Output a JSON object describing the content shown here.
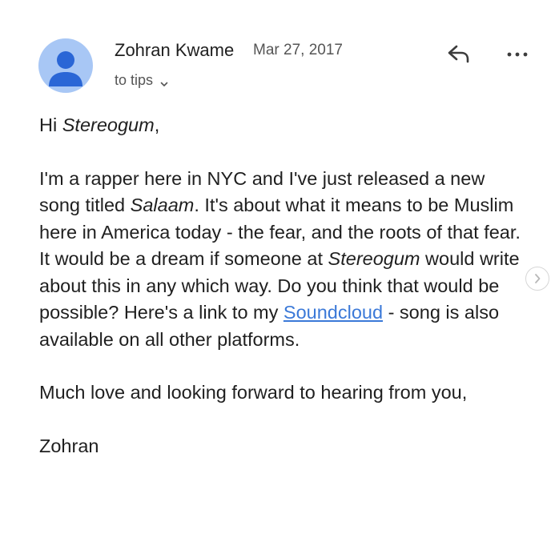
{
  "sender": {
    "name": "Zohran Kwame",
    "date": "Mar 27, 2017",
    "avatar_color": "#a8c7f5",
    "avatar_icon": "person-icon"
  },
  "recipient": {
    "label": "to tips"
  },
  "actions": {
    "reply_icon": "reply-icon",
    "more_icon": "more-horizontal-icon"
  },
  "body": {
    "greeting_prefix": "Hi ",
    "greeting_name": "Stereogum",
    "greeting_suffix": ",",
    "p1_a": "I'm a rapper here in NYC and I've just released a new song titled ",
    "p1_song": "Salaam",
    "p1_b": ". It's about what it means to be Muslim here in America today - the fear, and the roots of that fear. It would be a dream if someone at ",
    "p1_outlet": "Stereogum",
    "p1_c": " would write about this in any which way. Do you think that would be possible? Here's a link to my ",
    "p1_link": "Soundcloud",
    "p1_d": " - song is also available on all other platforms.",
    "p2": "Much love and looking forward to hearing from you,",
    "signature": "Zohran",
    "link_color": "#3b79d8"
  },
  "carousel": {
    "next_icon": "chevron-right-icon"
  }
}
